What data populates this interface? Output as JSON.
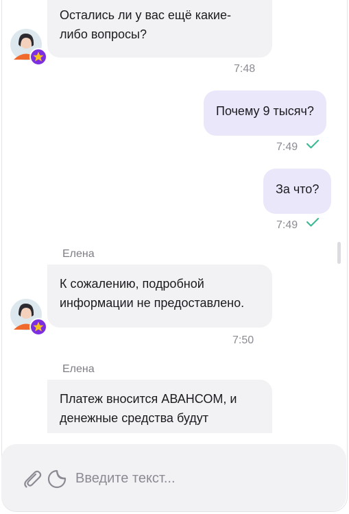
{
  "messages": [
    {
      "kind": "incoming",
      "text_lines": [
        "Остались ли у вас ещё какие-",
        "либо вопросы?"
      ],
      "time": "7:48"
    },
    {
      "kind": "outgoing",
      "text": "Почему 9 тысяч?",
      "time": "7:49",
      "status": "read"
    },
    {
      "kind": "outgoing",
      "text": "За что?",
      "time": "7:49",
      "status": "read"
    },
    {
      "kind": "incoming",
      "sender": "Елена",
      "text_lines": [
        "К сожалению, подробной",
        "информации не предоставлено."
      ],
      "time": "7:50"
    },
    {
      "kind": "incoming",
      "sender": "Елена",
      "text_lines": [
        "Платеж вносится АВАНСОМ, и",
        "денежные средства будут"
      ]
    }
  ],
  "composer": {
    "placeholder": "Введите текст..."
  },
  "icons": {
    "attach": "paperclip-icon",
    "sticker": "sticker-icon",
    "read": "check-icon",
    "avatar_badge": "star-icon"
  },
  "colors": {
    "outgoing_bubble": "#ebe7fa",
    "incoming_bubble": "#f2f2f4",
    "check": "#3fb995",
    "badge": "#7b2fe0",
    "badge_star": "#f7c21c"
  }
}
